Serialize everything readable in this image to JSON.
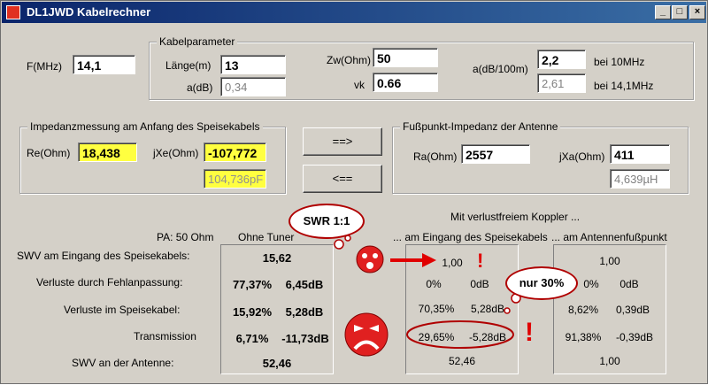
{
  "window": {
    "title": "DL1JWD Kabelrechner"
  },
  "freq": {
    "label": "F(MHz)",
    "value": "14,1"
  },
  "kabel": {
    "group_label": "Kabelparameter",
    "laenge_label": "Länge(m)",
    "laenge": "13",
    "adb_label": "a(dB)",
    "adb": "0,34",
    "zw_label": "Zw(Ohm)",
    "zw": "50",
    "vk_label": "vk",
    "vk": "0.66",
    "adb100_label": "a(dB/100m)",
    "adb100_a": "2,2",
    "adb100_a_label": "bei 10MHz",
    "adb100_b": "2,61",
    "adb100_b_label": "bei 14,1MHz"
  },
  "imp": {
    "group_label": "Impedanzmessung am Anfang des Speisekabels",
    "re_label": "Re(Ohm)",
    "re": "18,438",
    "jxe_label": "jXe(Ohm)",
    "jxe": "-107,772",
    "cap": "104,736pF"
  },
  "buttons": {
    "forward": "==>",
    "back": "<=="
  },
  "antenne": {
    "group_label": "Fußpunkt-Impedanz der Antenne",
    "ra_label": "Ra(Ohm)",
    "ra": "2557",
    "jxa_label": "jXa(Ohm)",
    "jxa": "411",
    "ind": "4,639µH"
  },
  "results": {
    "pa_label": "PA: 50 Ohm",
    "col_ohne": "Ohne Tuner",
    "koppler_header": "Mit verlustfreiem Koppler ...",
    "col_eingang": "... am Eingang des Speisekabels",
    "col_fusspunkt": "... am Antennenfußpunkt",
    "rows": [
      {
        "label": "SWV am Eingang des Speisekabels:",
        "ohne_a": "15,62",
        "ohne_b": "",
        "ein_a": "1,00",
        "ein_b": "",
        "fuss_a": "1,00",
        "fuss_b": ""
      },
      {
        "label": "Verluste durch Fehlanpassung:",
        "ohne_a": "77,37%",
        "ohne_b": "6,45dB",
        "ein_a": "0%",
        "ein_b": "0dB",
        "fuss_a": "0%",
        "fuss_b": "0dB"
      },
      {
        "label": "Verluste im Speisekabel:",
        "ohne_a": "15,92%",
        "ohne_b": "5,28dB",
        "ein_a": "70,35%",
        "ein_b": "5,28dB",
        "fuss_a": "8,62%",
        "fuss_b": "0,39dB"
      },
      {
        "label": "Transmission",
        "ohne_a": "6,71%",
        "ohne_b": "-11,73dB",
        "ein_a": "29,65%",
        "ein_b": "-5,28dB",
        "fuss_a": "91,38%",
        "fuss_b": "-0,39dB"
      },
      {
        "label": "SWV an der Antenne:",
        "ohne_a": "52,46",
        "ohne_b": "",
        "ein_a": "52,46",
        "ein_b": "",
        "fuss_a": "1,00",
        "fuss_b": ""
      }
    ]
  },
  "annotations": {
    "swr_cloud": "SWR 1:1",
    "nur_cloud": "nur 30%",
    "exclaim": "!"
  },
  "colors": {
    "highlight": "#ffff40",
    "annotation": "#e00000",
    "titlebar": "#0a246a"
  }
}
